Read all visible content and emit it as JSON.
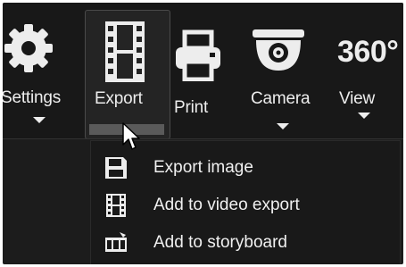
{
  "toolbar": {
    "settings": {
      "label": "Settings",
      "icon": "gear-icon"
    },
    "export": {
      "label": "Export",
      "icon": "film-strip-icon"
    },
    "print": {
      "label": "Print",
      "icon": "printer-icon"
    },
    "camera": {
      "label": "Camera",
      "icon": "dome-camera-icon"
    },
    "view": {
      "label": "View",
      "glyph": "360°",
      "icon": "view-360-icon"
    }
  },
  "export_menu": {
    "items": [
      {
        "label": "Export image",
        "icon": "save-icon"
      },
      {
        "label": "Add to video export",
        "icon": "film-strip-icon"
      },
      {
        "label": "Add to storyboard",
        "icon": "storyboard-icon"
      }
    ]
  },
  "colors": {
    "background": "#1c1c1c",
    "text": "#ededed",
    "hover_border": "#4a4a4a"
  }
}
